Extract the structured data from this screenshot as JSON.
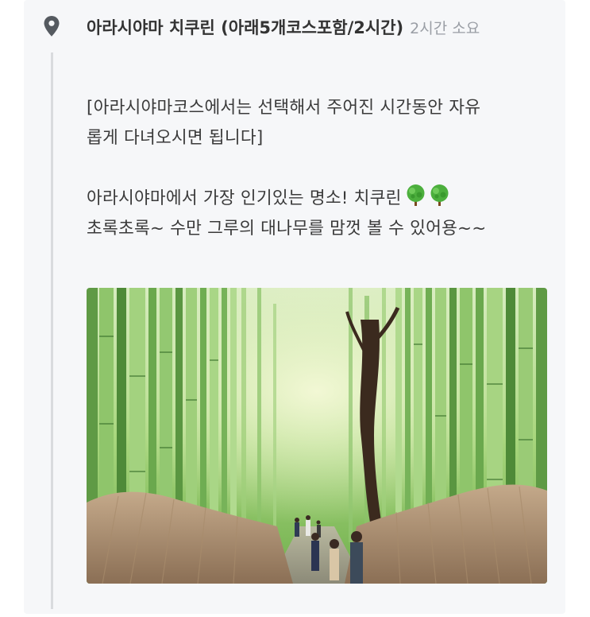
{
  "header": {
    "title": "아라시야마 치쿠린 (아래5개코스포함/2시간)",
    "duration": "2시간 소요"
  },
  "body": {
    "line1": "[아라시야마코스에서는 선택해서 주어진 시간동안 자유",
    "line2": "롭게 다녀오시면 됩니다]",
    "line3": "아라시야마에서 가장 인기있는 명소! 치쿠린",
    "line4": "초록초록~ 수만 그루의 대나무를 맘껏 볼 수 있어용~~"
  },
  "icons": {
    "location": "map-pin-icon",
    "emoji": "deciduous-tree-icon"
  },
  "photo": {
    "subject": "bamboo-grove-path-photo"
  },
  "colors": {
    "card_bg": "#f6f7f9",
    "timeline": "#d9dbde",
    "muted_text": "#9a9ea5",
    "text": "#3a3a3a",
    "pin": "#555a60"
  }
}
